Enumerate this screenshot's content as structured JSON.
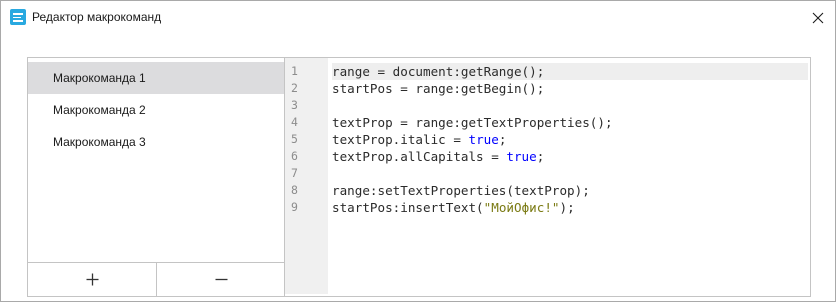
{
  "window": {
    "title": "Редактор макрокоманд",
    "icon": "document-lines-icon",
    "accent_color": "#29a9e0"
  },
  "macros": {
    "items": [
      {
        "label": "Макрокоманда 1",
        "selected": true
      },
      {
        "label": "Макрокоманда 2",
        "selected": false
      },
      {
        "label": "Макрокоманда 3",
        "selected": false
      }
    ],
    "add_label": "+",
    "remove_label": "−"
  },
  "editor": {
    "line_numbers": [
      "1",
      "2",
      "3",
      "4",
      "5",
      "6",
      "7",
      "8",
      "9"
    ],
    "current_line": 1,
    "keyword_color": "#0000ff",
    "string_color": "#7a7a13",
    "lines": [
      [
        {
          "t": "range = document:getRange();",
          "k": "plain"
        }
      ],
      [
        {
          "t": "startPos = range:getBegin();",
          "k": "plain"
        }
      ],
      [],
      [
        {
          "t": "textProp = range:getTextProperties();",
          "k": "plain"
        }
      ],
      [
        {
          "t": "textProp.italic = ",
          "k": "plain"
        },
        {
          "t": "true",
          "k": "kw"
        },
        {
          "t": ";",
          "k": "plain"
        }
      ],
      [
        {
          "t": "textProp.allCapitals = ",
          "k": "plain"
        },
        {
          "t": "true",
          "k": "kw"
        },
        {
          "t": ";",
          "k": "plain"
        }
      ],
      [],
      [
        {
          "t": "range:setTextProperties(textProp);",
          "k": "plain"
        }
      ],
      [
        {
          "t": "startPos:insertText(",
          "k": "plain"
        },
        {
          "t": "\"МойОфис!\"",
          "k": "str"
        },
        {
          "t": ");",
          "k": "plain"
        }
      ]
    ]
  }
}
